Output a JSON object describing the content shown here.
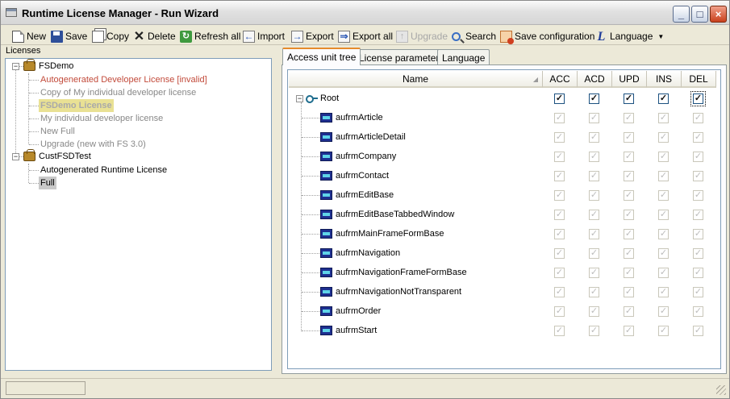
{
  "window": {
    "title": "Runtime License Manager - Run Wizard",
    "controls": {
      "minimize": "_",
      "maximize": "□",
      "close": "×"
    }
  },
  "toolbar": {
    "items": [
      {
        "label": "New",
        "icon": "new-document-icon",
        "enabled": true
      },
      {
        "label": "Save",
        "icon": "floppy-disk-icon",
        "enabled": true
      },
      {
        "label": "Copy",
        "icon": "copy-icon",
        "enabled": true
      },
      {
        "label": "Delete",
        "icon": "delete-x-icon",
        "enabled": true
      },
      {
        "label": "Refresh all",
        "icon": "refresh-icon",
        "enabled": true
      },
      {
        "label": "Import",
        "icon": "import-icon",
        "enabled": true
      },
      {
        "label": "Export",
        "icon": "export-icon",
        "enabled": true
      },
      {
        "label": "Export all",
        "icon": "export-all-icon",
        "enabled": true
      },
      {
        "label": "Upgrade",
        "icon": "upgrade-icon",
        "enabled": false
      },
      {
        "label": "Search",
        "icon": "magnifier-icon",
        "enabled": true
      },
      {
        "label": "Save configuration",
        "icon": "save-configuration-icon",
        "enabled": true
      },
      {
        "label": "Language",
        "icon": "language-icon",
        "enabled": true,
        "dropdown": true
      }
    ]
  },
  "licenses": {
    "label": "Licenses",
    "groups": [
      {
        "name": "FSDemo",
        "expanded": true,
        "items": [
          {
            "label": "Autogenerated Developer License [invalid]",
            "state": "invalid"
          },
          {
            "label": "Copy of My individual developer license",
            "state": "grey"
          },
          {
            "label": "FSDemo License",
            "state": "selected"
          },
          {
            "label": "My individual developer license",
            "state": "grey"
          },
          {
            "label": "New Full",
            "state": "grey"
          },
          {
            "label": "Upgrade (new with FS 3.0)",
            "state": "grey"
          }
        ]
      },
      {
        "name": "CustFSDTest",
        "expanded": true,
        "items": [
          {
            "label": "Autogenerated Runtime License",
            "state": "normal"
          },
          {
            "label": "Full",
            "state": "highlighted"
          }
        ]
      }
    ]
  },
  "tabs": [
    {
      "label": "Access unit tree",
      "active": true
    },
    {
      "label": "License parameters",
      "active": false
    },
    {
      "label": "Language",
      "active": false
    }
  ],
  "grid": {
    "columns": [
      "Name",
      "ACC",
      "ACD",
      "UPD",
      "INS",
      "DEL"
    ],
    "root": {
      "label": "Root",
      "checks": [
        true,
        true,
        true,
        true,
        true
      ],
      "enabled": true
    },
    "rows": [
      {
        "label": "aufrmArticle",
        "checks": [
          true,
          true,
          true,
          true,
          true
        ],
        "enabled": false
      },
      {
        "label": "aufrmArticleDetail",
        "checks": [
          true,
          true,
          true,
          true,
          true
        ],
        "enabled": false
      },
      {
        "label": "aufrmCompany",
        "checks": [
          true,
          true,
          true,
          true,
          true
        ],
        "enabled": false
      },
      {
        "label": "aufrmContact",
        "checks": [
          true,
          true,
          true,
          true,
          true
        ],
        "enabled": false
      },
      {
        "label": "aufrmEditBase",
        "checks": [
          true,
          true,
          true,
          true,
          true
        ],
        "enabled": false
      },
      {
        "label": "aufrmEditBaseTabbedWindow",
        "checks": [
          true,
          true,
          true,
          true,
          true
        ],
        "enabled": false
      },
      {
        "label": "aufrmMainFrameFormBase",
        "checks": [
          true,
          true,
          true,
          true,
          true
        ],
        "enabled": false
      },
      {
        "label": "aufrmNavigation",
        "checks": [
          true,
          true,
          true,
          true,
          true
        ],
        "enabled": false
      },
      {
        "label": "aufrmNavigationFrameFormBase",
        "checks": [
          true,
          true,
          true,
          true,
          true
        ],
        "enabled": false
      },
      {
        "label": "aufrmNavigationNotTransparent",
        "checks": [
          true,
          true,
          true,
          true,
          true
        ],
        "enabled": false
      },
      {
        "label": "aufrmOrder",
        "checks": [
          true,
          true,
          true,
          true,
          true
        ],
        "enabled": false
      },
      {
        "label": "aufrmStart",
        "checks": [
          true,
          true,
          true,
          true,
          true
        ],
        "enabled": false
      }
    ]
  },
  "statusbar": {
    "text": ""
  }
}
